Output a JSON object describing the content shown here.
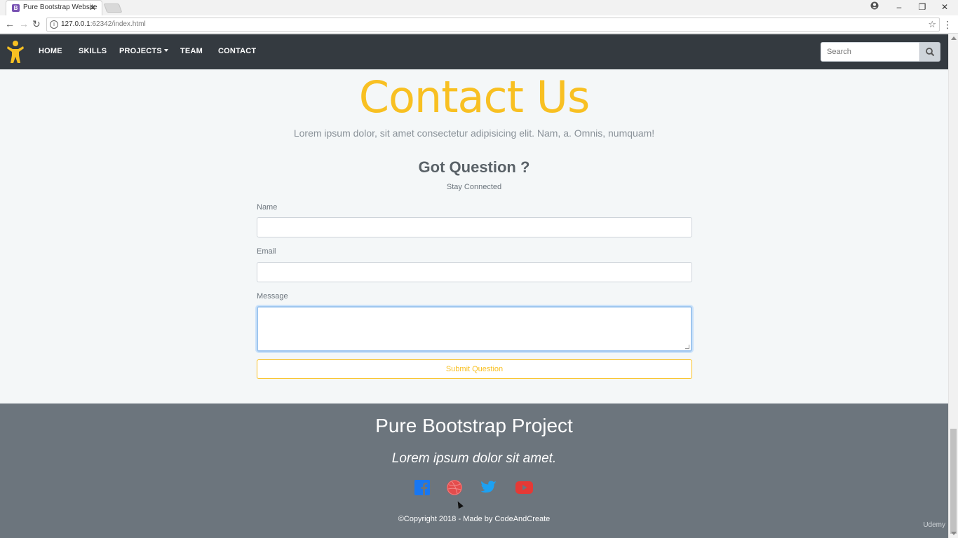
{
  "browser": {
    "tab_title": "Pure Bootstrap Website",
    "tab_favicon": "B",
    "tab_close": "✕",
    "url_host": "127.0.0.1",
    "url_path": ":62342/index.html",
    "window_controls": [
      "account-icon",
      "minimize-icon",
      "restore-icon",
      "close-icon"
    ]
  },
  "navbar": {
    "brand_icon": "person-icon",
    "links": [
      "HOME",
      "SKILLS",
      "PROJECTS",
      "TEAM",
      "CONTACT"
    ],
    "search_placeholder": "Search",
    "search_icon": "search-icon"
  },
  "contact": {
    "title": "Contact Us",
    "lead": "Lorem ipsum dolor, sit amet consectetur adipisicing elit. Nam, a. Omnis, numquam!",
    "heading": "Got Question ?",
    "subheading": "Stay Connected",
    "name_label": "Name",
    "email_label": "Email",
    "message_label": "Message",
    "submit_label": "Submit Question"
  },
  "footer": {
    "title": "Pure Bootstrap Project",
    "subtitle": "Lorem ipsum dolor sit amet.",
    "social_icons": [
      "facebook-icon",
      "dribbble-icon",
      "twitter-icon",
      "youtube-icon"
    ],
    "copyright": "©Copyright 2018 - Made by CodeAndCreate"
  },
  "colors": {
    "accent": "#f8c022",
    "navbar_bg": "#343a40",
    "footer_bg": "#6c757d",
    "facebook": "#1877f2",
    "dribbble": "#e44c4c",
    "twitter": "#1da1f2",
    "youtube": "#e53935"
  },
  "overlay": {
    "watermark": "Udemy"
  }
}
